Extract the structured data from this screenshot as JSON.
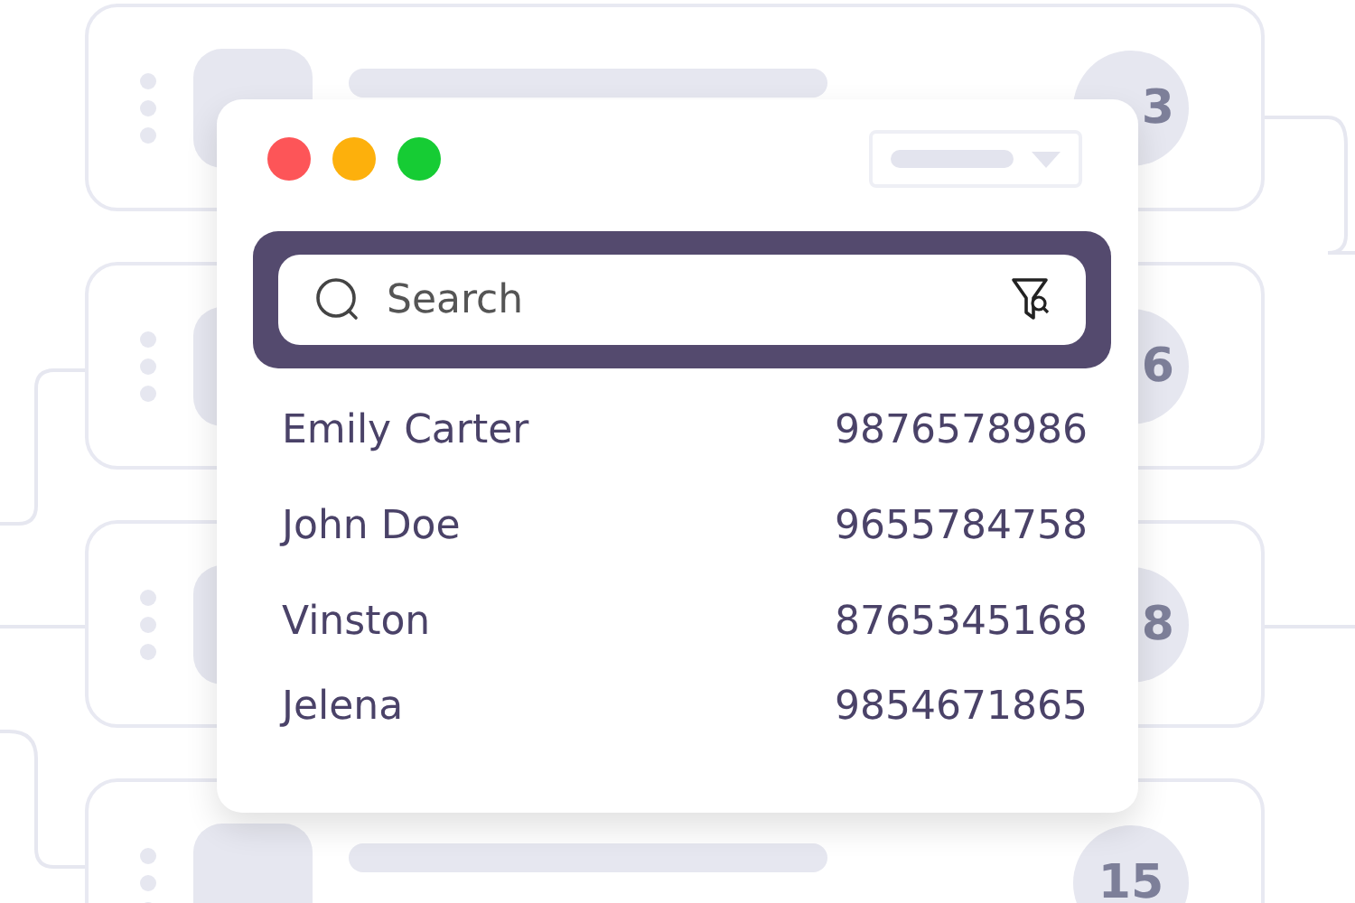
{
  "background_cards": [
    {
      "badge": "3"
    },
    {
      "badge": "6"
    },
    {
      "badge": "8"
    },
    {
      "badge": "15"
    }
  ],
  "window": {
    "search": {
      "placeholder": "Search"
    },
    "contacts": [
      {
        "name": "Emily Carter",
        "phone": "9876578986"
      },
      {
        "name": "John Doe",
        "phone": "9655784758"
      },
      {
        "name": "Vinston",
        "phone": "8765345168"
      },
      {
        "name": "Jelena",
        "phone": "9854671865"
      }
    ]
  }
}
